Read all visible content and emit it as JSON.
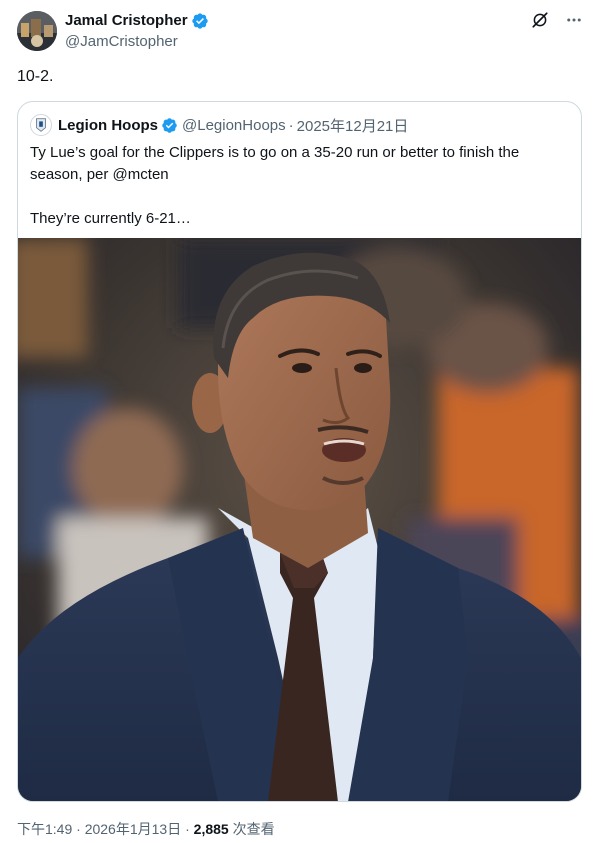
{
  "author": {
    "display_name": "Jamal Cristopher",
    "handle": "@JamCristopher",
    "verified_icon": "verified-badge-icon",
    "avatar_icon": "profile-avatar"
  },
  "actions": {
    "grok_icon": "grok-icon",
    "more_icon": "more-options-icon"
  },
  "tweet": {
    "text": "10-2."
  },
  "quote": {
    "display_name": "Legion Hoops",
    "handle": "@LegionHoops",
    "separator": "·",
    "date": "2025年12月21日",
    "text_line1": "Ty Lue’s goal for the Clippers is to go on a 35-20 run or better to finish the season, per @mcten",
    "text_line2": "They’re currently 6-21…",
    "image_alt": "Photo of a basketball coach in a navy suit, white shirt and brown tie, courtside with blurred crowd behind"
  },
  "meta": {
    "time": "下午1:49",
    "separator": "·",
    "date": "2026年1月13日",
    "separator2": "·",
    "views_count": "2,885",
    "views_label": " 次查看"
  },
  "colors": {
    "text_primary": "#0f1419",
    "text_secondary": "#536471",
    "verified_blue": "#1d9bf0",
    "border": "#cfd9de",
    "suit_navy": "#26344f",
    "tie_brown": "#3a2621",
    "shirt": "#dfe8f3"
  }
}
